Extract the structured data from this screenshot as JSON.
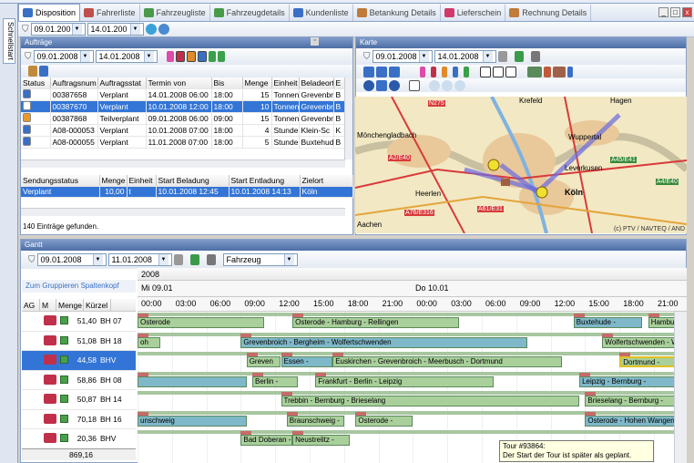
{
  "tabs": [
    {
      "label": "Disposition",
      "active": true,
      "color": "#3a6fc6"
    },
    {
      "label": "Fahrerliste",
      "color": "#c0504d"
    },
    {
      "label": "Fahrzeugliste",
      "color": "#4a9a4a"
    },
    {
      "label": "Fahrzeugdetails",
      "color": "#4a9a4a"
    },
    {
      "label": "Kundenliste",
      "color": "#3a6fc6"
    },
    {
      "label": "Betankung Details",
      "color": "#c07a3a"
    },
    {
      "label": "Lieferschein",
      "color": "#d03a6a"
    },
    {
      "label": "Rechnung Details",
      "color": "#c07a3a"
    }
  ],
  "sidebar_tab": "Schnellstart",
  "top_toolbar": {
    "date_from": "09.01.200",
    "date_to": "14.01.200"
  },
  "auftraege": {
    "title": "Aufträge",
    "date_from": "09.01.2008",
    "date_to": "14.01.2008",
    "columns": [
      "Status",
      "Auftragsnum",
      "Auftragsstat",
      "Termin von",
      "Bis",
      "Menge",
      "Einheit",
      "Beladeort",
      "E"
    ],
    "rows": [
      {
        "status": "#3a6fc6",
        "nr": "00387658",
        "stat": "Verplant",
        "von": "14.01.2008 06:00",
        "bis": "18:00",
        "menge": "15",
        "einheit": "Tonnen",
        "ort": "Grevenbr",
        "e": "B",
        "selected": false
      },
      {
        "status": "#ffffff",
        "nr": "00387670",
        "stat": "Verplant",
        "von": "10.01.2008 12:00",
        "bis": "18:00",
        "menge": "10",
        "einheit": "Tonnen",
        "ort": "Grevenbr",
        "e": "B",
        "selected": true
      },
      {
        "status": "#e89a2a",
        "nr": "00387868",
        "stat": "Teilverplant",
        "von": "09.01.2008 06:00",
        "bis": "09:00",
        "menge": "15",
        "einheit": "Tonnen",
        "ort": "Grevenbr",
        "e": "B",
        "selected": false
      },
      {
        "status": "#3a6fc6",
        "nr": "A08-000053",
        "stat": "Verplant",
        "von": "10.01.2008 07:00",
        "bis": "18:00",
        "menge": "4",
        "einheit": "Stunde",
        "ort": "Klein-Sc",
        "e": "K",
        "selected": false
      },
      {
        "status": "#3a6fc6",
        "nr": "A08-000055",
        "stat": "Verplant",
        "von": "11.01.2008 07:00",
        "bis": "18:00",
        "menge": "5",
        "einheit": "Stunde",
        "ort": "Buxtehud",
        "e": "B",
        "selected": false
      }
    ],
    "sub_columns": [
      "Sendungsstatus",
      "Menge",
      "Einheit",
      "Start Beladung",
      "Start Entladung",
      "Zielort"
    ],
    "sub_rows": [
      {
        "status": "Verplant",
        "menge": "10,00",
        "einheit": "t",
        "beladung": "10.01.2008 12:45",
        "entladung": "10.01.2008 14:13",
        "ziel": "Köln"
      }
    ],
    "count_text": "140 Einträge gefunden."
  },
  "karte": {
    "title": "Karte",
    "date_from": "09.01.2008",
    "date_to": "14.01.2008",
    "labels": [
      "Hagen",
      "Krefeld",
      "Mönchengladbach",
      "Wuppertal",
      "Leverkusen",
      "Köln",
      "Heerlen",
      "A2/E40",
      "A45/E41",
      "A4/E40",
      "N275",
      "A61/E31",
      "A76/E316",
      "Aachen"
    ],
    "copyright": "(c) PTV / NAVTEQ / AND"
  },
  "gantt": {
    "title": "Gantt",
    "date_from": "09.01.2008",
    "date_to": "11.01.2008",
    "resource_type": "Fahrzeug",
    "group_hint": "Zum Gruppieren Spaltenkopf",
    "year": "2008",
    "days": [
      "Mi 09.01",
      "Do 10.01"
    ],
    "hours": [
      "00:00",
      "03:00",
      "06:00",
      "09:00",
      "12:00",
      "15:00",
      "18:00",
      "21:00",
      "00:00",
      "03:00",
      "06:00",
      "09:00",
      "12:00",
      "15:00",
      "18:00",
      "21:00"
    ],
    "columns": [
      "AG",
      "M",
      "Menge",
      "Kürzel"
    ],
    "rows": [
      {
        "menge": "51,40",
        "kuerzel": "BH 07",
        "selected": false
      },
      {
        "menge": "51,08",
        "kuerzel": "BH 18",
        "selected": false
      },
      {
        "menge": "44,58",
        "kuerzel": "BHV",
        "selected": true
      },
      {
        "menge": "58,86",
        "kuerzel": "BH 08",
        "selected": false
      },
      {
        "menge": "50,87",
        "kuerzel": "BH 14",
        "selected": false
      },
      {
        "menge": "70,18",
        "kuerzel": "BH 16",
        "selected": false
      },
      {
        "menge": "20,36",
        "kuerzel": "BHV",
        "selected": false
      }
    ],
    "total": "869,16",
    "bars": [
      {
        "row": 0,
        "label": "Osterode",
        "start": 0,
        "end": 11
      },
      {
        "row": 0,
        "label": "Osterode - Hamburg - Rellingen",
        "start": 13.5,
        "end": 28
      },
      {
        "row": 0,
        "label": "Buxtehude -",
        "start": 38,
        "end": 44
      },
      {
        "row": 0,
        "label": "Hamburg -",
        "start": 44.5,
        "end": 50
      },
      {
        "row": 1,
        "label": "oh",
        "start": 0,
        "end": 2
      },
      {
        "row": 1,
        "label": "Grevenbroich - Bergheim - Wolfertschwenden",
        "start": 9,
        "end": 34
      },
      {
        "row": 1,
        "label": "Wolfertschwenden - Westerstetten - Barby",
        "start": 40.5,
        "end": 63
      },
      {
        "row": 2,
        "label": "Greven",
        "start": 9.5,
        "end": 12.5
      },
      {
        "row": 2,
        "label": "Essen -",
        "start": 12.5,
        "end": 17
      },
      {
        "row": 2,
        "label": "Euskirchen - Grevenbroich - Meerbusch - Dortmund",
        "start": 17,
        "end": 37
      },
      {
        "row": 2,
        "label": "Dortmund -",
        "start": 42,
        "end": 47
      },
      {
        "row": 3,
        "label": "",
        "start": 0,
        "end": 9.5
      },
      {
        "row": 3,
        "label": "Berlin -",
        "start": 10,
        "end": 14
      },
      {
        "row": 3,
        "label": "Frankfurt - Berlin - Leipzig",
        "start": 15.5,
        "end": 31
      },
      {
        "row": 3,
        "label": "Leipzig - Bernburg -",
        "start": 38.5,
        "end": 49
      },
      {
        "row": 4,
        "label": "Trebbin - Bernburg - Brieselang",
        "start": 12.5,
        "end": 38.5
      },
      {
        "row": 4,
        "label": "Brieselang - Bernburg -",
        "start": 39,
        "end": 50
      },
      {
        "row": 5,
        "label": "unschweig",
        "start": 0,
        "end": 9.5
      },
      {
        "row": 5,
        "label": "Braunschweig -",
        "start": 13,
        "end": 18
      },
      {
        "row": 5,
        "label": "Osterode -",
        "start": 19,
        "end": 24
      },
      {
        "row": 5,
        "label": "Osterode - Hohen Wangen",
        "start": 39,
        "end": 50
      },
      {
        "row": 6,
        "label": "Bad Doberan -",
        "start": 9,
        "end": 13.5
      },
      {
        "row": 6,
        "label": "Neustrelitz -",
        "start": 13.5,
        "end": 18.5
      }
    ],
    "tooltip": {
      "line1": "Tour #93864:",
      "line2": "Der Start der Tour ist später als geplant."
    }
  }
}
